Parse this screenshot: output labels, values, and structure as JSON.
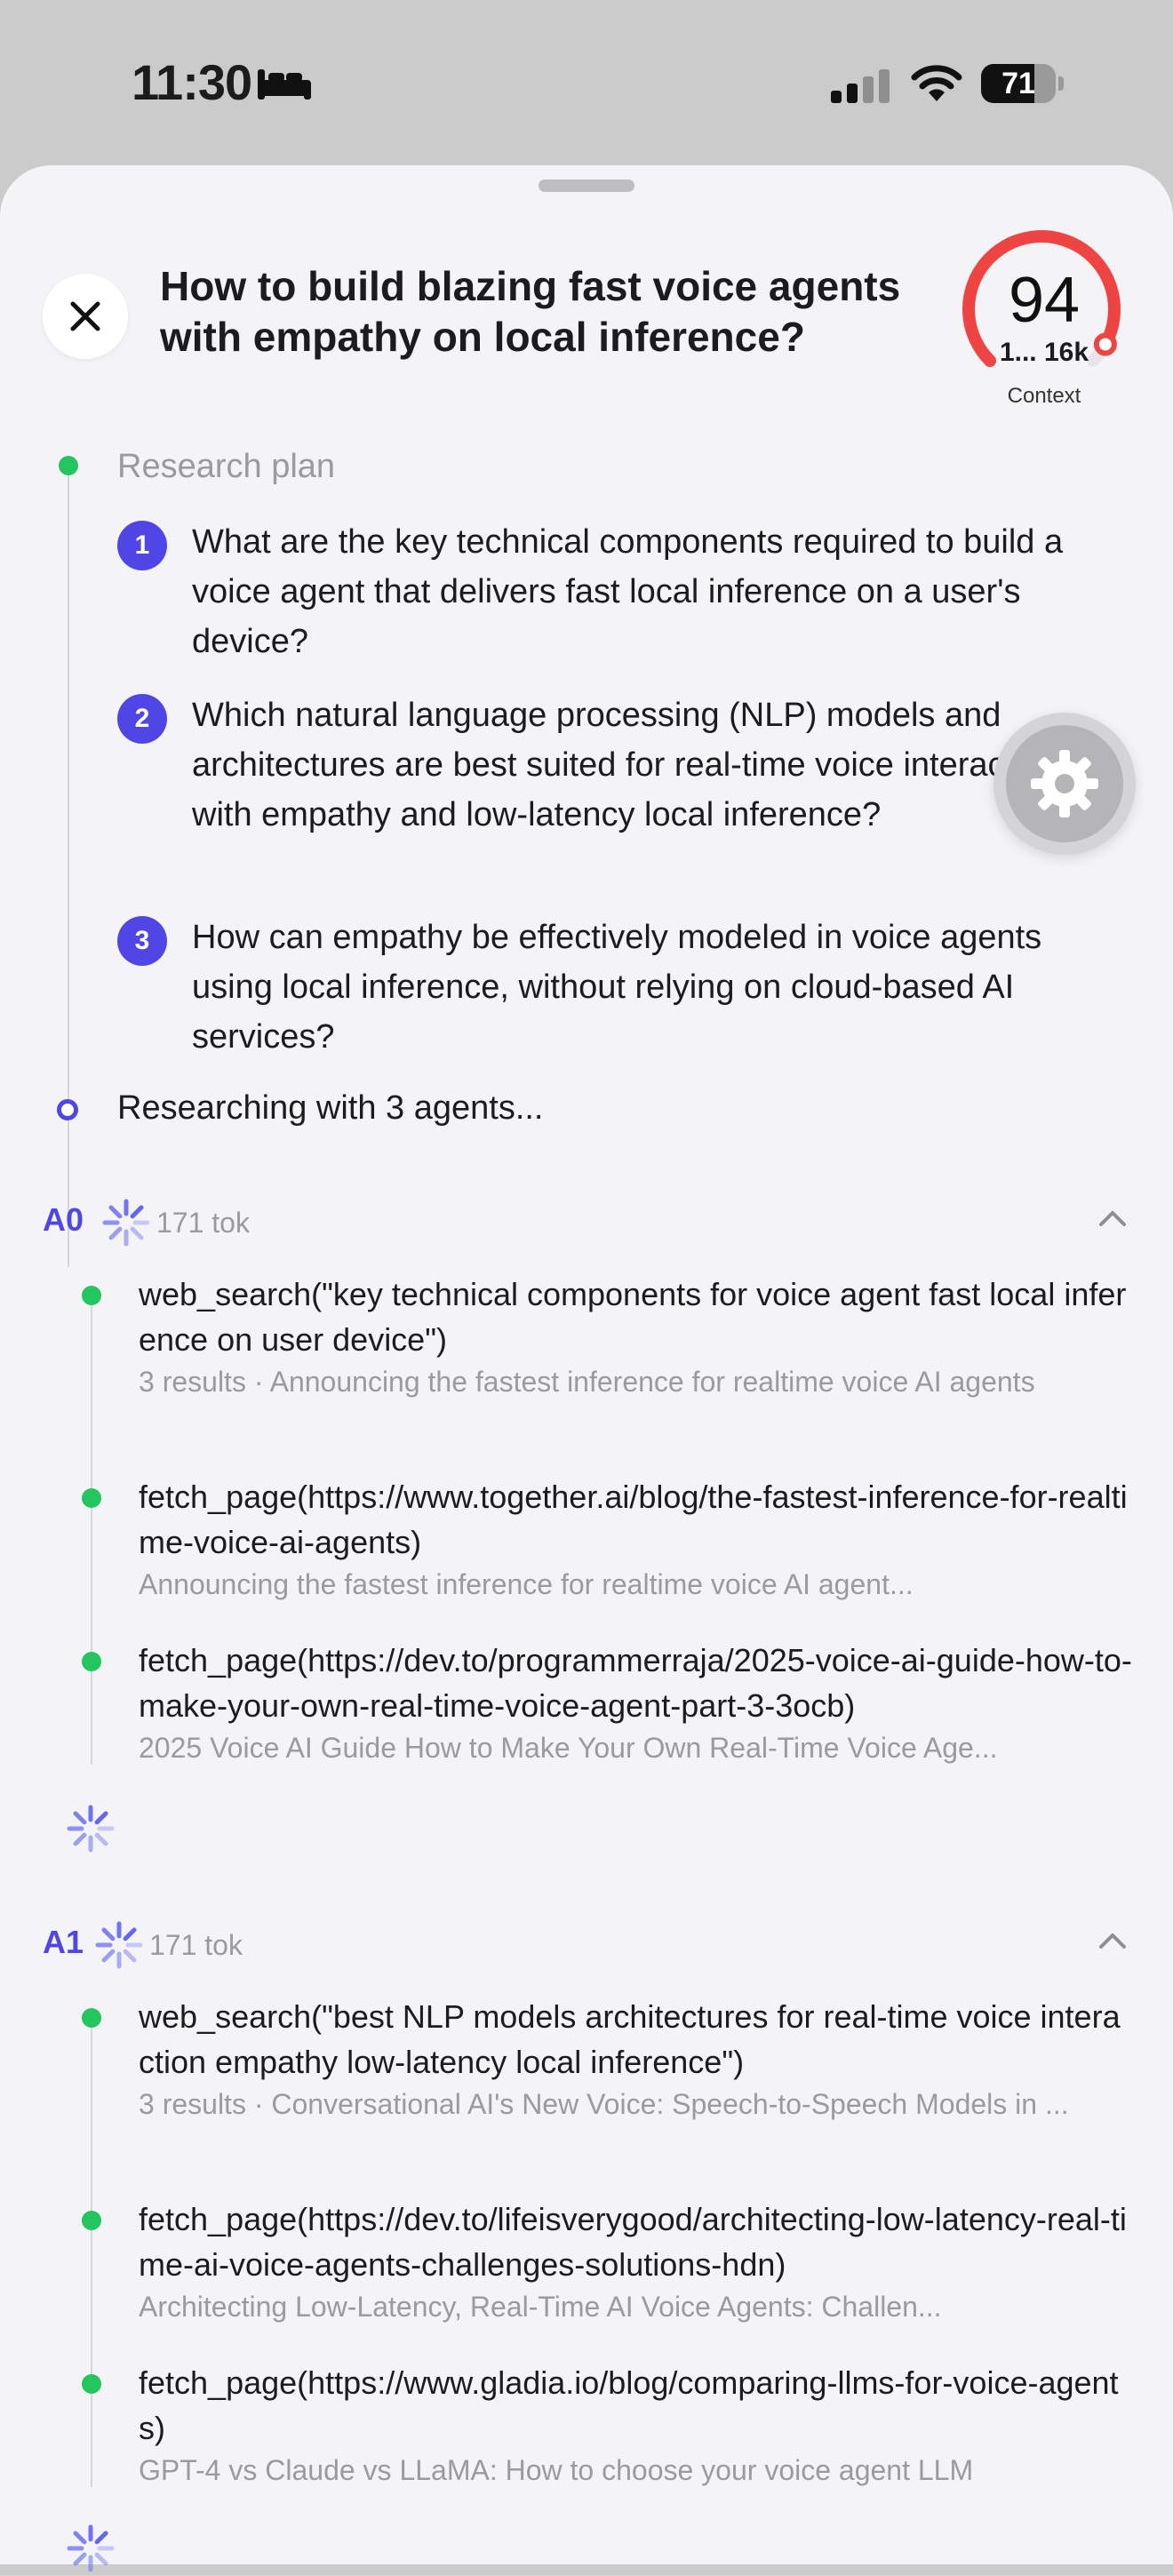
{
  "status_bar": {
    "time": "11:30",
    "battery": "71",
    "battery_level": 0.71
  },
  "header": {
    "title": "How to build blazing fast voice agents with empathy on local inference?",
    "context_gauge": {
      "value": "94",
      "sub": "1... 16k",
      "label": "Context",
      "level": 0.94,
      "color": "#ef4444"
    }
  },
  "plan": {
    "label": "Research plan",
    "steps": [
      {
        "num": "1",
        "text": "What are the key technical components required to build a voice agent that delivers fast local inference on a user's device?"
      },
      {
        "num": "2",
        "text": "Which natural language processing (NLP) models and architectures are best suited for real-time voice interaction with empathy and low-latency local inference?"
      },
      {
        "num": "3",
        "text": "How can empathy be effectively modeled in voice agents using local inference, without relying on cloud-based AI services?"
      }
    ],
    "status": "Researching with 3 agents..."
  },
  "agents": [
    {
      "id": "A0",
      "tokens": "171 tok",
      "tools": [
        {
          "call": "web_search(\"key technical components for voice agent fast local inference on user device\")",
          "result": "3 results · Announcing the fastest inference for realtime voice AI agents"
        },
        {
          "call": "fetch_page(https://www.together.ai/blog/the-fastest-inference-for-realtime-voice-ai-agents)",
          "result": "Announcing the fastest inference for realtime voice AI agent..."
        },
        {
          "call": "fetch_page(https://dev.to/programmerraja/2025-voice-ai-guide-how-to-make-your-own-real-time-voice-agent-part-3-3ocb)",
          "result": "2025 Voice AI Guide How to Make Your Own Real-Time Voice Age..."
        }
      ]
    },
    {
      "id": "A1",
      "tokens": "171 tok",
      "tools": [
        {
          "call": "web_search(\"best NLP models architectures for real-time voice interaction empathy low-latency local inference\")",
          "result": "3 results · Conversational AI's New Voice: Speech-to-Speech Models in ..."
        },
        {
          "call": "fetch_page(https://dev.to/lifeisverygood/architecting-low-latency-real-time-ai-voice-agents-challenges-solutions-hdn)",
          "result": "Architecting Low-Latency, Real-Time AI Voice Agents: Challen..."
        },
        {
          "call": "fetch_page(https://www.gladia.io/blog/comparing-llms-for-voice-agents)",
          "result": "GPT-4 vs Claude vs LLaMA: How to choose your voice agent LLM"
        }
      ]
    }
  ],
  "colors": {
    "accent": "#4f46e5",
    "success": "#22c55e",
    "gauge": "#ef4444"
  }
}
